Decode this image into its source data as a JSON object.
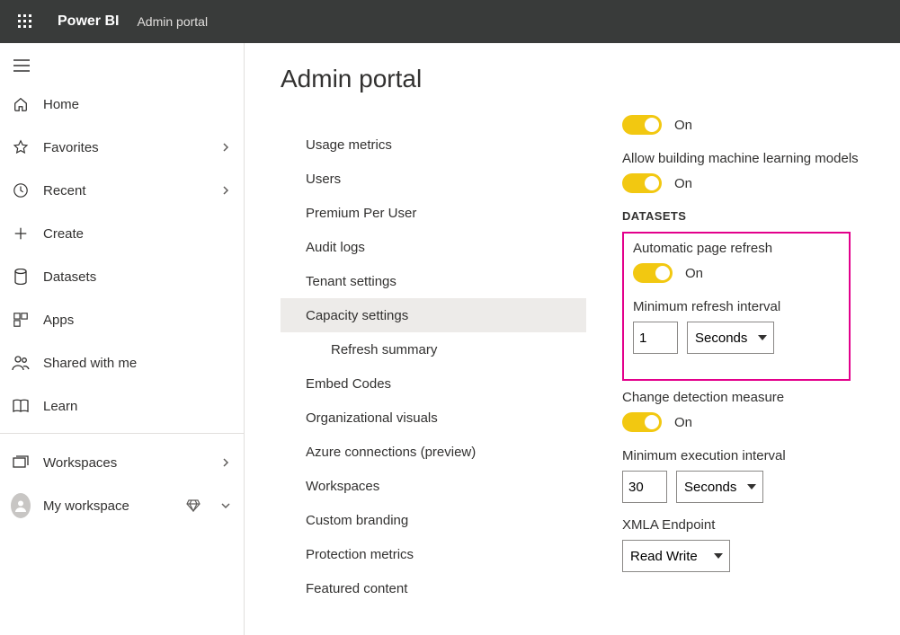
{
  "topbar": {
    "product": "Power BI",
    "section": "Admin portal"
  },
  "sidebar": {
    "items": [
      {
        "label": "Home"
      },
      {
        "label": "Favorites",
        "expandable": true
      },
      {
        "label": "Recent",
        "expandable": true
      },
      {
        "label": "Create"
      },
      {
        "label": "Datasets"
      },
      {
        "label": "Apps"
      },
      {
        "label": "Shared with me"
      },
      {
        "label": "Learn"
      }
    ],
    "workspaces_label": "Workspaces",
    "my_workspace_label": "My workspace"
  },
  "page": {
    "title": "Admin portal"
  },
  "admin_menu": {
    "items": [
      "Usage metrics",
      "Users",
      "Premium Per User",
      "Audit logs",
      "Tenant settings",
      "Capacity settings",
      "Refresh summary",
      "Embed Codes",
      "Organizational visuals",
      "Azure connections (preview)",
      "Workspaces",
      "Custom branding",
      "Protection metrics",
      "Featured content"
    ],
    "selected": "Capacity settings"
  },
  "settings": {
    "toggle_on_label": "On",
    "allow_ml_label": "Allow building machine learning models",
    "datasets_header": "DATASETS",
    "auto_refresh_label": "Automatic page refresh",
    "min_refresh_label": "Minimum refresh interval",
    "min_refresh_value": "1",
    "min_refresh_unit": "Seconds",
    "change_detection_label": "Change detection measure",
    "min_exec_label": "Minimum execution interval",
    "min_exec_value": "30",
    "min_exec_unit": "Seconds",
    "xmla_label": "XMLA Endpoint",
    "xmla_value": "Read Write"
  }
}
